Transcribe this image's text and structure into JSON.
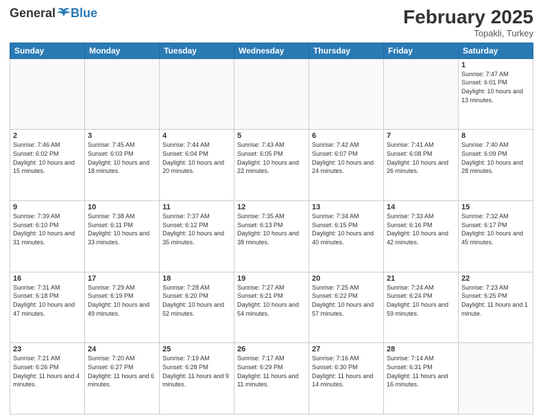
{
  "header": {
    "logo_general": "General",
    "logo_blue": "Blue",
    "month_title": "February 2025",
    "location": "Topakli, Turkey"
  },
  "weekdays": [
    "Sunday",
    "Monday",
    "Tuesday",
    "Wednesday",
    "Thursday",
    "Friday",
    "Saturday"
  ],
  "weeks": [
    [
      {
        "day": "",
        "info": ""
      },
      {
        "day": "",
        "info": ""
      },
      {
        "day": "",
        "info": ""
      },
      {
        "day": "",
        "info": ""
      },
      {
        "day": "",
        "info": ""
      },
      {
        "day": "",
        "info": ""
      },
      {
        "day": "1",
        "info": "Sunrise: 7:47 AM\nSunset: 6:01 PM\nDaylight: 10 hours and 13 minutes."
      }
    ],
    [
      {
        "day": "2",
        "info": "Sunrise: 7:46 AM\nSunset: 6:02 PM\nDaylight: 10 hours and 15 minutes."
      },
      {
        "day": "3",
        "info": "Sunrise: 7:45 AM\nSunset: 6:03 PM\nDaylight: 10 hours and 18 minutes."
      },
      {
        "day": "4",
        "info": "Sunrise: 7:44 AM\nSunset: 6:04 PM\nDaylight: 10 hours and 20 minutes."
      },
      {
        "day": "5",
        "info": "Sunrise: 7:43 AM\nSunset: 6:05 PM\nDaylight: 10 hours and 22 minutes."
      },
      {
        "day": "6",
        "info": "Sunrise: 7:42 AM\nSunset: 6:07 PM\nDaylight: 10 hours and 24 minutes."
      },
      {
        "day": "7",
        "info": "Sunrise: 7:41 AM\nSunset: 6:08 PM\nDaylight: 10 hours and 26 minutes."
      },
      {
        "day": "8",
        "info": "Sunrise: 7:40 AM\nSunset: 6:09 PM\nDaylight: 10 hours and 28 minutes."
      }
    ],
    [
      {
        "day": "9",
        "info": "Sunrise: 7:39 AM\nSunset: 6:10 PM\nDaylight: 10 hours and 31 minutes."
      },
      {
        "day": "10",
        "info": "Sunrise: 7:38 AM\nSunset: 6:11 PM\nDaylight: 10 hours and 33 minutes."
      },
      {
        "day": "11",
        "info": "Sunrise: 7:37 AM\nSunset: 6:12 PM\nDaylight: 10 hours and 35 minutes."
      },
      {
        "day": "12",
        "info": "Sunrise: 7:35 AM\nSunset: 6:13 PM\nDaylight: 10 hours and 38 minutes."
      },
      {
        "day": "13",
        "info": "Sunrise: 7:34 AM\nSunset: 6:15 PM\nDaylight: 10 hours and 40 minutes."
      },
      {
        "day": "14",
        "info": "Sunrise: 7:33 AM\nSunset: 6:16 PM\nDaylight: 10 hours and 42 minutes."
      },
      {
        "day": "15",
        "info": "Sunrise: 7:32 AM\nSunset: 6:17 PM\nDaylight: 10 hours and 45 minutes."
      }
    ],
    [
      {
        "day": "16",
        "info": "Sunrise: 7:31 AM\nSunset: 6:18 PM\nDaylight: 10 hours and 47 minutes."
      },
      {
        "day": "17",
        "info": "Sunrise: 7:29 AM\nSunset: 6:19 PM\nDaylight: 10 hours and 49 minutes."
      },
      {
        "day": "18",
        "info": "Sunrise: 7:28 AM\nSunset: 6:20 PM\nDaylight: 10 hours and 52 minutes."
      },
      {
        "day": "19",
        "info": "Sunrise: 7:27 AM\nSunset: 6:21 PM\nDaylight: 10 hours and 54 minutes."
      },
      {
        "day": "20",
        "info": "Sunrise: 7:25 AM\nSunset: 6:22 PM\nDaylight: 10 hours and 57 minutes."
      },
      {
        "day": "21",
        "info": "Sunrise: 7:24 AM\nSunset: 6:24 PM\nDaylight: 10 hours and 59 minutes."
      },
      {
        "day": "22",
        "info": "Sunrise: 7:23 AM\nSunset: 6:25 PM\nDaylight: 11 hours and 1 minute."
      }
    ],
    [
      {
        "day": "23",
        "info": "Sunrise: 7:21 AM\nSunset: 6:26 PM\nDaylight: 11 hours and 4 minutes."
      },
      {
        "day": "24",
        "info": "Sunrise: 7:20 AM\nSunset: 6:27 PM\nDaylight: 11 hours and 6 minutes."
      },
      {
        "day": "25",
        "info": "Sunrise: 7:19 AM\nSunset: 6:28 PM\nDaylight: 11 hours and 9 minutes."
      },
      {
        "day": "26",
        "info": "Sunrise: 7:17 AM\nSunset: 6:29 PM\nDaylight: 11 hours and 11 minutes."
      },
      {
        "day": "27",
        "info": "Sunrise: 7:16 AM\nSunset: 6:30 PM\nDaylight: 11 hours and 14 minutes."
      },
      {
        "day": "28",
        "info": "Sunrise: 7:14 AM\nSunset: 6:31 PM\nDaylight: 11 hours and 16 minutes."
      },
      {
        "day": "",
        "info": ""
      }
    ]
  ]
}
